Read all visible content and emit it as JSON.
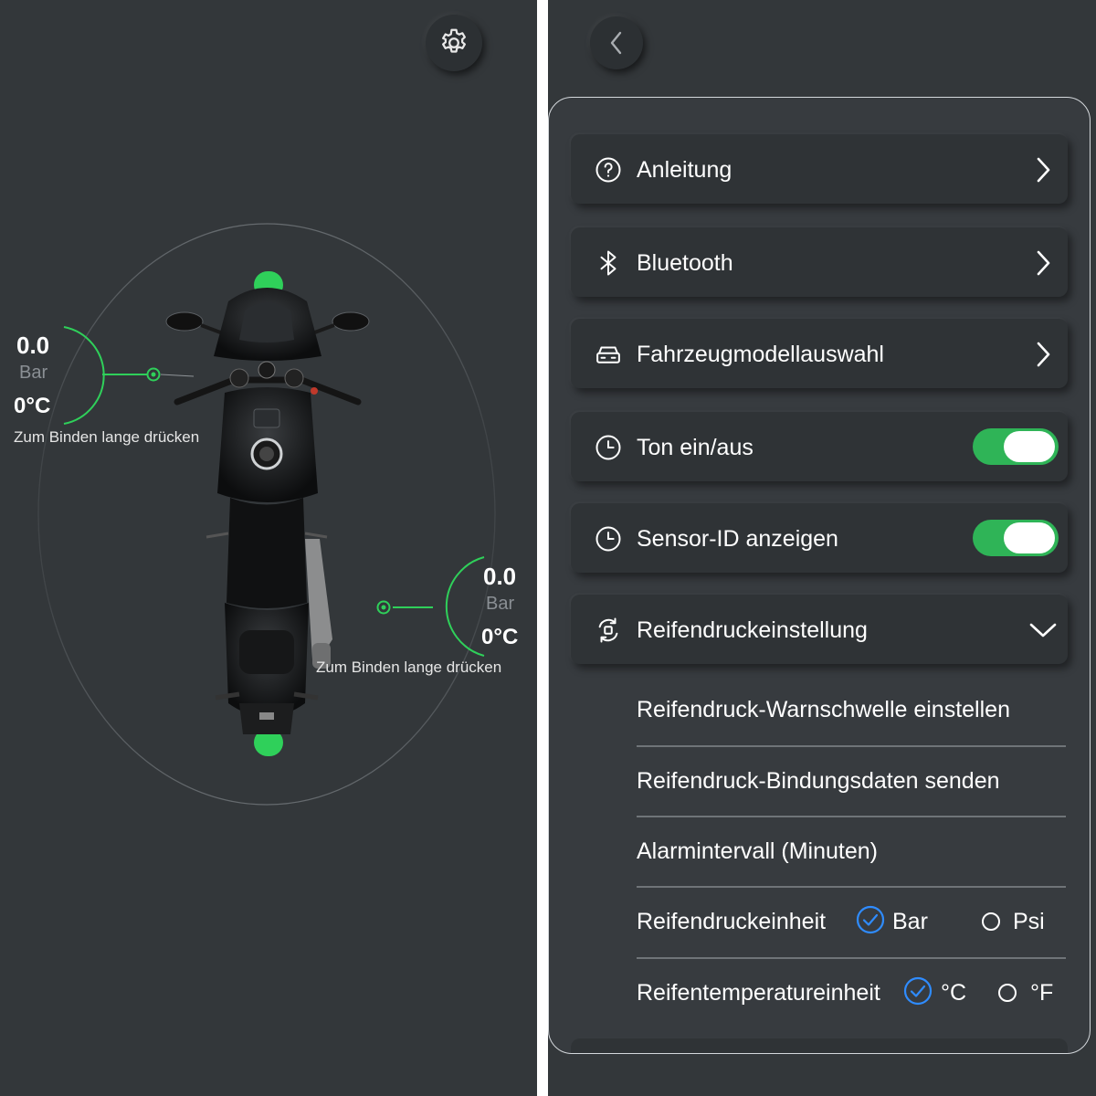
{
  "tpms": {
    "front_left": {
      "pressure": "0.0",
      "unit": "Bar",
      "temperature": "0°C",
      "hint": "Zum Binden lange drücken"
    },
    "rear_right": {
      "pressure": "0.0",
      "unit": "Bar",
      "temperature": "0°C",
      "hint": "Zum Binden lange drücken"
    },
    "accent_color": "#2fd05a"
  },
  "settings": {
    "menu": [
      {
        "label": "Anleitung",
        "icon": "help-circle-icon",
        "control": "chevron-right"
      },
      {
        "label": "Bluetooth",
        "icon": "bluetooth-icon",
        "control": "chevron-right"
      },
      {
        "label": "Fahrzeugmodellauswahl",
        "icon": "car-icon",
        "control": "chevron-right"
      },
      {
        "label": "Ton ein/aus",
        "icon": "clock-icon",
        "control": "toggle",
        "enabled": true
      },
      {
        "label": "Sensor-ID anzeigen",
        "icon": "clock-icon",
        "control": "toggle",
        "enabled": true
      },
      {
        "label": "Reifendruckeinstellung",
        "icon": "tire-sync-icon",
        "control": "chevron-down",
        "expanded": true
      }
    ],
    "submenu": [
      {
        "label": "Reifendruck-Warnschwelle einstellen"
      },
      {
        "label": "Reifendruck-Bindungsdaten senden"
      },
      {
        "label": "Alarmintervall (Minuten)"
      }
    ],
    "pressure_unit": {
      "label": "Reifendruckeinheit",
      "options": [
        "Bar",
        "Psi"
      ],
      "selected": "Bar"
    },
    "temperature_unit": {
      "label": "Reifentemperatureinheit",
      "options": [
        "°C",
        "°F"
      ],
      "selected": "°C"
    },
    "toggle_on_color": "#2fb457",
    "radio_checked_color": "#2f8cff"
  }
}
